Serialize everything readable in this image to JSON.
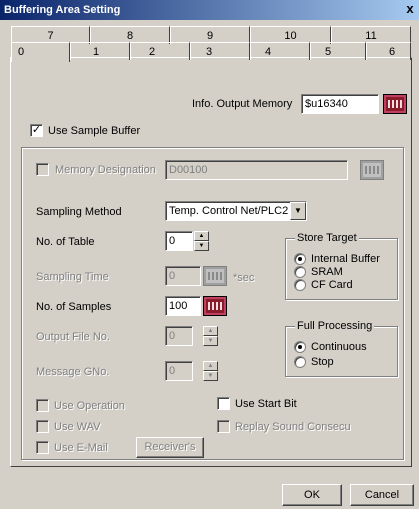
{
  "window": {
    "title": "Buffering Area Setting",
    "close": "x"
  },
  "tabs_back": [
    "7",
    "8",
    "9",
    "10",
    "11"
  ],
  "tabs_front": [
    "0",
    "1",
    "2",
    "3",
    "4",
    "5",
    "6"
  ],
  "info_output": {
    "label": "Info. Output Memory",
    "value": "$u16340"
  },
  "use_sample_buffer": {
    "label": "Use Sample Buffer",
    "checked": true
  },
  "memory_designation": {
    "label": "Memory Designation",
    "value": "D00100"
  },
  "sampling_method": {
    "label": "Sampling Method",
    "value": "Temp. Control Net/PLC2"
  },
  "no_of_table": {
    "label": "No. of Table",
    "value": "0"
  },
  "sampling_time": {
    "label": "Sampling Time",
    "value": "0",
    "unit": "*sec"
  },
  "no_of_samples": {
    "label": "No. of Samples",
    "value": "100"
  },
  "output_file_no": {
    "label": "Output File No.",
    "value": "0"
  },
  "message_gno": {
    "label": "Message GNo.",
    "value": "0"
  },
  "store_target": {
    "title": "Store Target",
    "options": [
      "Internal Buffer",
      "SRAM",
      "CF Card"
    ],
    "selected": "Internal Buffer"
  },
  "full_processing": {
    "title": "Full Processing",
    "options": [
      "Continuous",
      "Stop"
    ],
    "selected": "Continuous"
  },
  "checks": {
    "use_operation": "Use Operation",
    "use_start_bit": "Use Start Bit",
    "use_wav": "Use WAV",
    "replay_sound": "Replay Sound Consecu",
    "use_email": "Use E-Mail"
  },
  "receivers_button": "Receiver's",
  "footer": {
    "ok": "OK",
    "cancel": "Cancel"
  },
  "icons": {
    "keypad": "keypad-icon",
    "spin": "spin-icon",
    "dropdown": "chevron-down-icon"
  },
  "colors": {
    "title_start": "#0a246a",
    "title_end": "#a6caf0",
    "keypad_red": "#8b1a2a",
    "face": "#d4d0c8"
  }
}
